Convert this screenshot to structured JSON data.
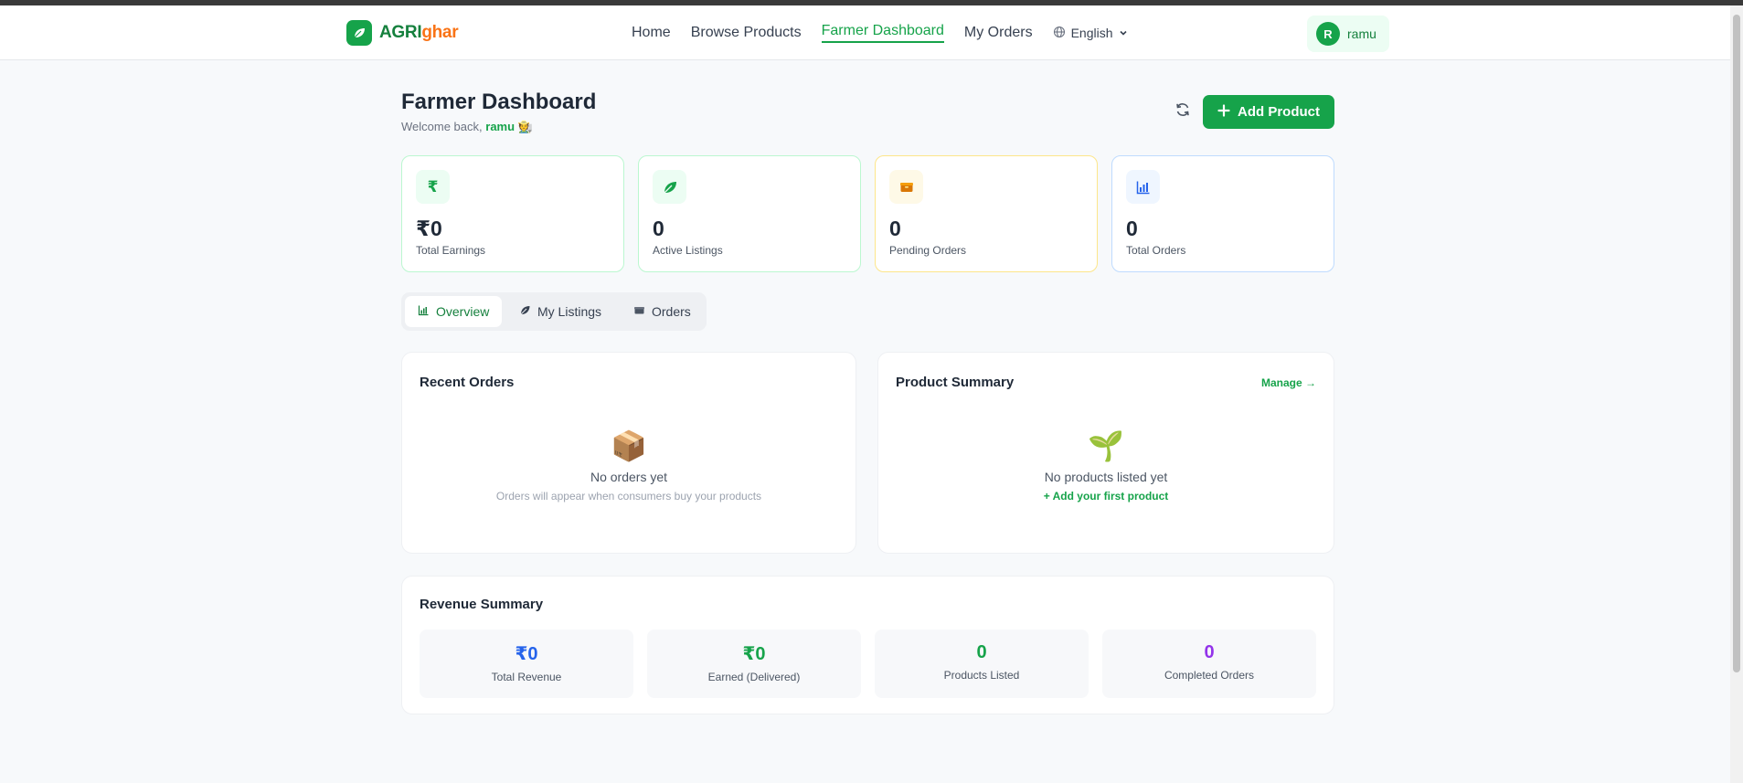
{
  "brand": {
    "part1": "AGRI",
    "part2": "ghar"
  },
  "nav": {
    "links": [
      "Home",
      "Browse Products",
      "Farmer Dashboard",
      "My Orders"
    ],
    "active_index": 2,
    "language": "English"
  },
  "user": {
    "initial": "R",
    "name": "ramu"
  },
  "header": {
    "title": "Farmer Dashboard",
    "welcome_prefix": "Welcome back,",
    "welcome_name": "ramu",
    "welcome_emoji": "🧑‍🌾",
    "add_button": "Add Product"
  },
  "stats": [
    {
      "value": "₹0",
      "label": "Total Earnings",
      "icon": "rupee-icon"
    },
    {
      "value": "0",
      "label": "Active Listings",
      "icon": "leaf-icon"
    },
    {
      "value": "0",
      "label": "Pending Orders",
      "icon": "box-icon"
    },
    {
      "value": "0",
      "label": "Total Orders",
      "icon": "chart-icon"
    }
  ],
  "tabs": [
    "Overview",
    "My Listings",
    "Orders"
  ],
  "recent_orders": {
    "title": "Recent Orders",
    "empty_emoji": "📦",
    "empty_title": "No orders yet",
    "empty_sub": "Orders will appear when consumers buy your products"
  },
  "product_summary": {
    "title": "Product Summary",
    "manage": "Manage →",
    "empty_emoji": "🌱",
    "empty_title": "No products listed yet",
    "empty_link": "+ Add your first product"
  },
  "revenue": {
    "title": "Revenue Summary",
    "items": [
      {
        "value": "₹0",
        "label": "Total Revenue",
        "color": "#2563eb"
      },
      {
        "value": "₹0",
        "label": "Earned (Delivered)",
        "color": "#16a34a"
      },
      {
        "value": "0",
        "label": "Products Listed",
        "color": "#16a34a"
      },
      {
        "value": "0",
        "label": "Completed Orders",
        "color": "#9333ea"
      }
    ]
  }
}
